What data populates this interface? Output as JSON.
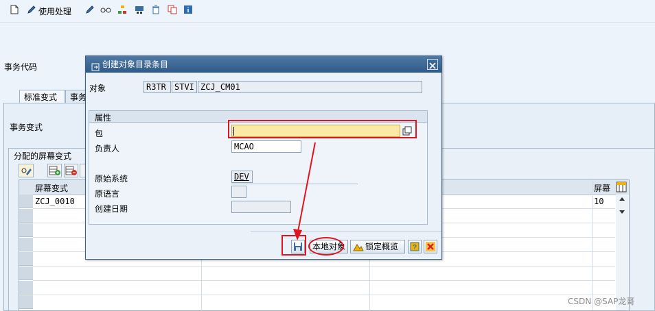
{
  "toolbar": {
    "use_process": "使用处理"
  },
  "main": {
    "tcode_label": "事务代码",
    "tabs": [
      {
        "label": "标准变式"
      },
      {
        "label": "事务"
      }
    ],
    "variant_label": "事务变式",
    "group_title": "分配的屏幕变式",
    "grid": {
      "col_screen_variant": "屏幕变式",
      "col_screen": "屏幕",
      "rows": [
        {
          "variant": "ZCJ_0010",
          "screen": "10"
        }
      ]
    }
  },
  "dialog": {
    "title": "创建对象目录条目",
    "object_label": "对象",
    "object_pgmid": "R3TR",
    "object_type": "STVI",
    "object_name": "ZCJ_CM01",
    "attr_title": "属性",
    "package_label": "包",
    "package_value": "",
    "owner_label": "负责人",
    "owner_value": "MCAO",
    "source_system_label": "原始系统",
    "source_system_value": "DEV",
    "orig_lang_label": "原语言",
    "orig_lang_value": "",
    "created_on_label": "创建日期",
    "created_on_value": "",
    "btn_local_object": "本地对象",
    "btn_lock_overview": "锁定概览"
  },
  "watermark": "CSDN @SAP龙哥",
  "colors": {
    "highlight": "#e0141e",
    "required_field": "#fbe9a6",
    "title_bar": "#2f5a87"
  }
}
